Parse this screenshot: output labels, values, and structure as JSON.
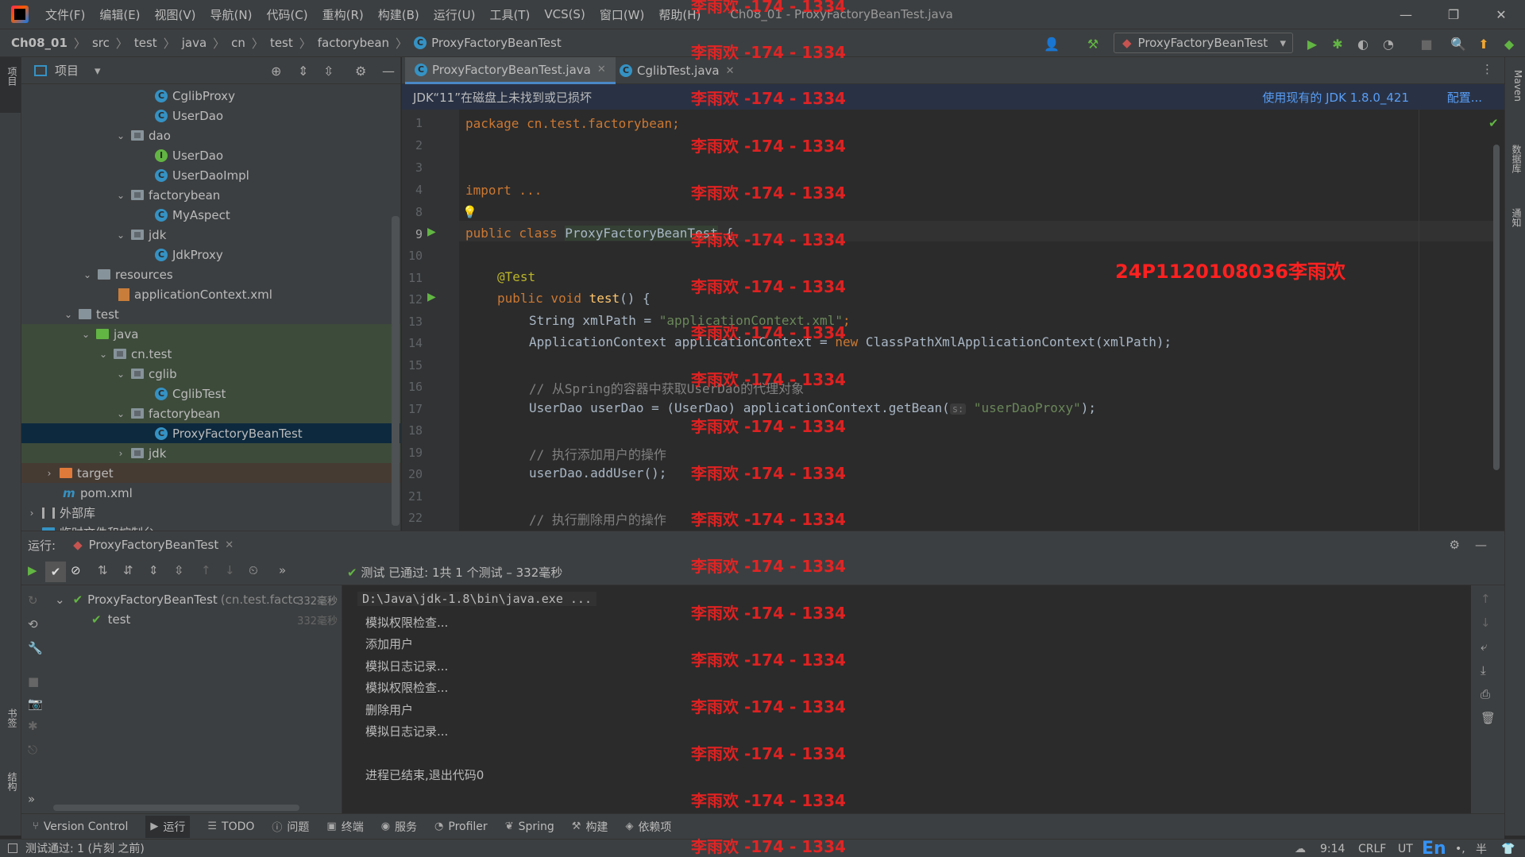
{
  "menu": {
    "items": [
      "文件(F)",
      "编辑(E)",
      "视图(V)",
      "导航(N)",
      "代码(C)",
      "重构(R)",
      "构建(B)",
      "运行(U)",
      "工具(T)",
      "VCS(S)",
      "窗口(W)",
      "帮助(H)"
    ],
    "window_title": "Ch08_01 - ProxyFactoryBeanTest.java"
  },
  "breadcrumbs": [
    "Ch08_01",
    "src",
    "test",
    "java",
    "cn",
    "test",
    "factorybean",
    "ProxyFactoryBeanTest"
  ],
  "run_config": "ProxyFactoryBeanTest",
  "left_strip": {
    "project_label": "项目",
    "bookmarks_label": "书签",
    "structure_label": "结构"
  },
  "right_strip": {
    "maven_label": "Maven",
    "database_label": "数据库",
    "notifications_label": "通知"
  },
  "project_panel": {
    "title": "项目",
    "tree": [
      {
        "label": "CglibProxy",
        "icon": "class"
      },
      {
        "label": "UserDao",
        "icon": "class"
      },
      {
        "label": "dao",
        "icon": "package"
      },
      {
        "label": "UserDao",
        "icon": "interface"
      },
      {
        "label": "UserDaoImpl",
        "icon": "class"
      },
      {
        "label": "factorybean",
        "icon": "package"
      },
      {
        "label": "MyAspect",
        "icon": "class"
      },
      {
        "label": "jdk",
        "icon": "package"
      },
      {
        "label": "JdkProxy",
        "icon": "class"
      },
      {
        "label": "resources",
        "icon": "resources-folder"
      },
      {
        "label": "applicationContext.xml",
        "icon": "xml"
      },
      {
        "label": "test",
        "icon": "folder"
      },
      {
        "label": "java",
        "icon": "test-folder"
      },
      {
        "label": "cn.test",
        "icon": "package"
      },
      {
        "label": "cglib",
        "icon": "package"
      },
      {
        "label": "CglibTest",
        "icon": "class"
      },
      {
        "label": "factorybean",
        "icon": "package"
      },
      {
        "label": "ProxyFactoryBeanTest",
        "icon": "class"
      },
      {
        "label": "jdk",
        "icon": "package"
      },
      {
        "label": "target",
        "icon": "excluded-folder"
      },
      {
        "label": "pom.xml",
        "icon": "maven"
      },
      {
        "label": "外部库",
        "icon": "library"
      },
      {
        "label": "临时文件和控制台",
        "icon": "scratch"
      }
    ]
  },
  "editor": {
    "tabs": [
      {
        "label": "ProxyFactoryBeanTest.java",
        "active": true
      },
      {
        "label": "CglibTest.java",
        "active": false
      }
    ],
    "jdk_banner": {
      "message": "JDK“11”在磁盘上未找到或已损坏",
      "use_existing": "使用现有的 JDK 1.8.0_421",
      "configure": "配置..."
    },
    "line_numbers": [
      "1",
      "2",
      "3",
      "4",
      "8",
      "9",
      "10",
      "11",
      "12",
      "13",
      "14",
      "15",
      "16",
      "17",
      "18",
      "19",
      "20",
      "21",
      "22"
    ],
    "code": {
      "l1": "package cn.test.factorybean;",
      "l4": "import ...",
      "l9a": "public class ",
      "l9b": "ProxyFactoryBeanTest",
      "l9c": " {",
      "l11": "@Test",
      "l12a": "public void ",
      "l12b": "test",
      "l12c": "() {",
      "l13a": "String xmlPath = ",
      "l13b": "\"applicationContext.xml\"",
      "l13c": ";",
      "l14a": "ApplicationContext applicationContext = ",
      "l14b": "new ",
      "l14c": "ClassPathXmlApplicationContext(xmlPath);",
      "l16": "// 从Spring的容器中获取UserDao的代理对象",
      "l17a": "UserDao userDao = (UserDao) applicationContext.getBean(",
      "l17hint": "s:",
      "l17b": " \"userDaoProxy\"",
      "l17c": ");",
      "l19": "// 执行添加用户的操作",
      "l20": "userDao.addUser();",
      "l22": "// 执行删除用户的操作"
    },
    "student_id": "24P1120108036李雨欢"
  },
  "run_panel": {
    "label": "运行:",
    "tab": "ProxyFactoryBeanTest",
    "status_prefix": "测试 已通过:",
    "status_count": "1共 1 个测试 – 332毫秒",
    "test_tree": [
      {
        "label": "ProxyFactoryBeanTest",
        "detail": "(cn.test.factc",
        "time": "332毫秒"
      },
      {
        "label": "test",
        "detail": "",
        "time": "332毫秒"
      }
    ],
    "console": [
      "D:\\Java\\jdk-1.8\\bin\\java.exe ...",
      "模拟权限检查...",
      "添加用户",
      "模拟日志记录...",
      "模拟权限检查...",
      "删除用户",
      "模拟日志记录...",
      "",
      "进程已结束,退出代码0"
    ]
  },
  "bottom_tools": [
    "Version Control",
    "运行",
    "TODO",
    "问题",
    "终端",
    "服务",
    "Profiler",
    "Spring",
    "构建",
    "依赖项"
  ],
  "status_bar": {
    "message": "测试通过: 1 (片刻 之前)",
    "position": "9:14",
    "line_sep": "CRLF",
    "encoding": "UT",
    "ime": "En",
    "ime_extra": "半"
  },
  "watermark": "李雨欢 -174 - 1334"
}
